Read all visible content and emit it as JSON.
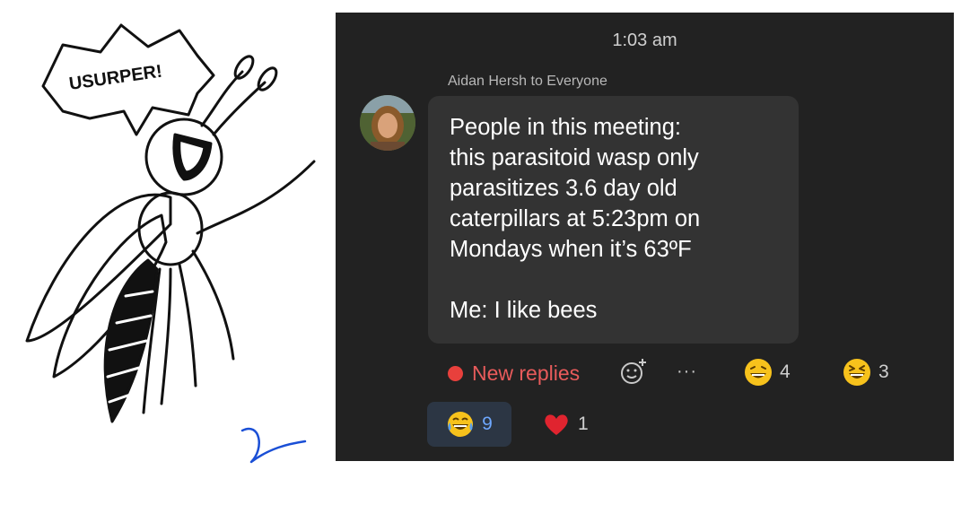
{
  "comic": {
    "speech": "USURPER!",
    "signature": "Kampaun"
  },
  "chat": {
    "time": "1:03 am",
    "sender_line": "Aidan Hersh to Everyone",
    "message": "People in this meeting:\nthis parasitoid wasp only parasitizes 3.6 day old caterpillars at 5:23pm on Mondays when it’s 63ºF\n\nMe: I like bees",
    "new_replies_label": "New replies",
    "more_label": "···",
    "reactions": [
      {
        "icon": "grinning-squinting-face-icon",
        "count": "4"
      },
      {
        "icon": "laughing-closed-eyes-face-icon",
        "count": "3"
      },
      {
        "icon": "tears-of-joy-face-icon",
        "count": "9",
        "selected": true
      },
      {
        "icon": "red-heart-icon",
        "count": "1"
      }
    ],
    "colors": {
      "background": "#222222",
      "bubble": "#333333",
      "new_replies": "#e85b5b",
      "selected_pill": "#2c3644",
      "selected_count": "#6ea8ff"
    }
  }
}
